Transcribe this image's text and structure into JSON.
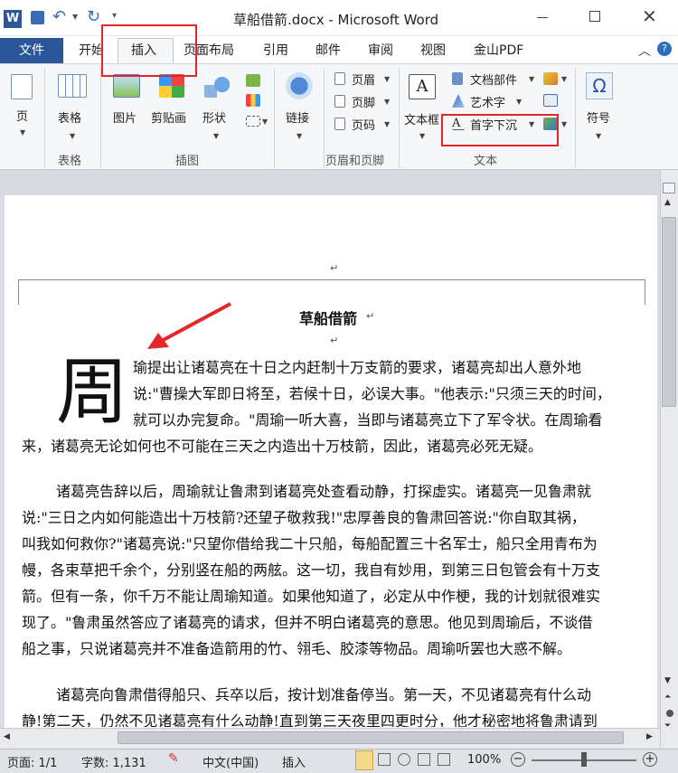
{
  "window": {
    "title": "草船借箭.docx - Microsoft Word"
  },
  "tabs": [
    {
      "label": "文件"
    },
    {
      "label": "开始"
    },
    {
      "label": "插入"
    },
    {
      "label": "页面布局"
    },
    {
      "label": "引用"
    },
    {
      "label": "邮件"
    },
    {
      "label": "审阅"
    },
    {
      "label": "视图"
    },
    {
      "label": "金山PDF"
    }
  ],
  "ribbon": {
    "pages": {
      "label": "页"
    },
    "table": {
      "label": "表格",
      "group": "表格"
    },
    "illustrations": {
      "picture": "图片",
      "clipart": "剪贴画",
      "shapes": "形状",
      "group": "插图"
    },
    "links": {
      "label": "链接"
    },
    "header_footer": {
      "header": "页眉",
      "footer": "页脚",
      "page_number": "页码",
      "group": "页眉和页脚"
    },
    "text": {
      "textbox": "文本框",
      "quickparts": "文档部件",
      "wordart": "艺术字",
      "dropcap": "首字下沉",
      "group": "文本"
    },
    "symbols": {
      "label": "符号",
      "omega": "Ω"
    }
  },
  "document": {
    "title": "草船借箭",
    "dropcap_char": "周",
    "para1_lines": [
      "瑜提出让诸葛亮在十日之内赶制十万支箭的要求，诸葛亮却出人意外地",
      "说:\"曹操大军即日将至，若候十日，必误大事。\"他表示:\"只须三天的时间，",
      "就可以办完复命。\"周瑜一听大喜，当即与诸葛亮立下了军令状。在周瑜看",
      "来，诸葛亮无论如何也不可能在三天之内造出十万枝箭，因此，诸葛亮必死无疑。"
    ],
    "para2_lines": [
      "诸葛亮告辞以后，周瑜就让鲁肃到诸葛亮处查看动静，打探虚实。诸葛亮一见鲁肃就",
      "说:\"三日之内如何能造出十万枝箭?还望子敬救我!\"忠厚善良的鲁肃回答说:\"你自取其祸，",
      "叫我如何救你?\"诸葛亮说:\"只望你借给我二十只船，每船配置三十名军士，船只全用青布为",
      "幔，各束草把千余个，分别竖在船的两舷。这一切，我自有妙用，到第三日包管会有十万支",
      "箭。但有一条，你千万不能让周瑜知道。如果他知道了，必定从中作梗，我的计划就很难实",
      "现了。\"鲁肃虽然答应了诸葛亮的请求，但并不明白诸葛亮的意思。他见到周瑜后，不谈借",
      "船之事，只说诸葛亮并不准备造箭用的竹、翎毛、胶漆等物品。周瑜听罢也大惑不解。"
    ],
    "para3_lines": [
      "诸葛亮向鲁肃借得船只、兵卒以后，按计划准备停当。第一天，不见诸葛亮有什么动",
      "静!第二天，仍然不见诸葛亮有什么动静!直到第三天夜里四更时分，他才秘密地将鲁肃请到"
    ]
  },
  "status": {
    "page": "页面: 1/1",
    "words": "字数: 1,131",
    "language": "中文(中国)",
    "mode": "插入",
    "zoom": "100%"
  },
  "colors": {
    "file_tab": "#2b579a",
    "highlight": "#e4262b",
    "ribbon_bg": "#f6f7f8"
  }
}
